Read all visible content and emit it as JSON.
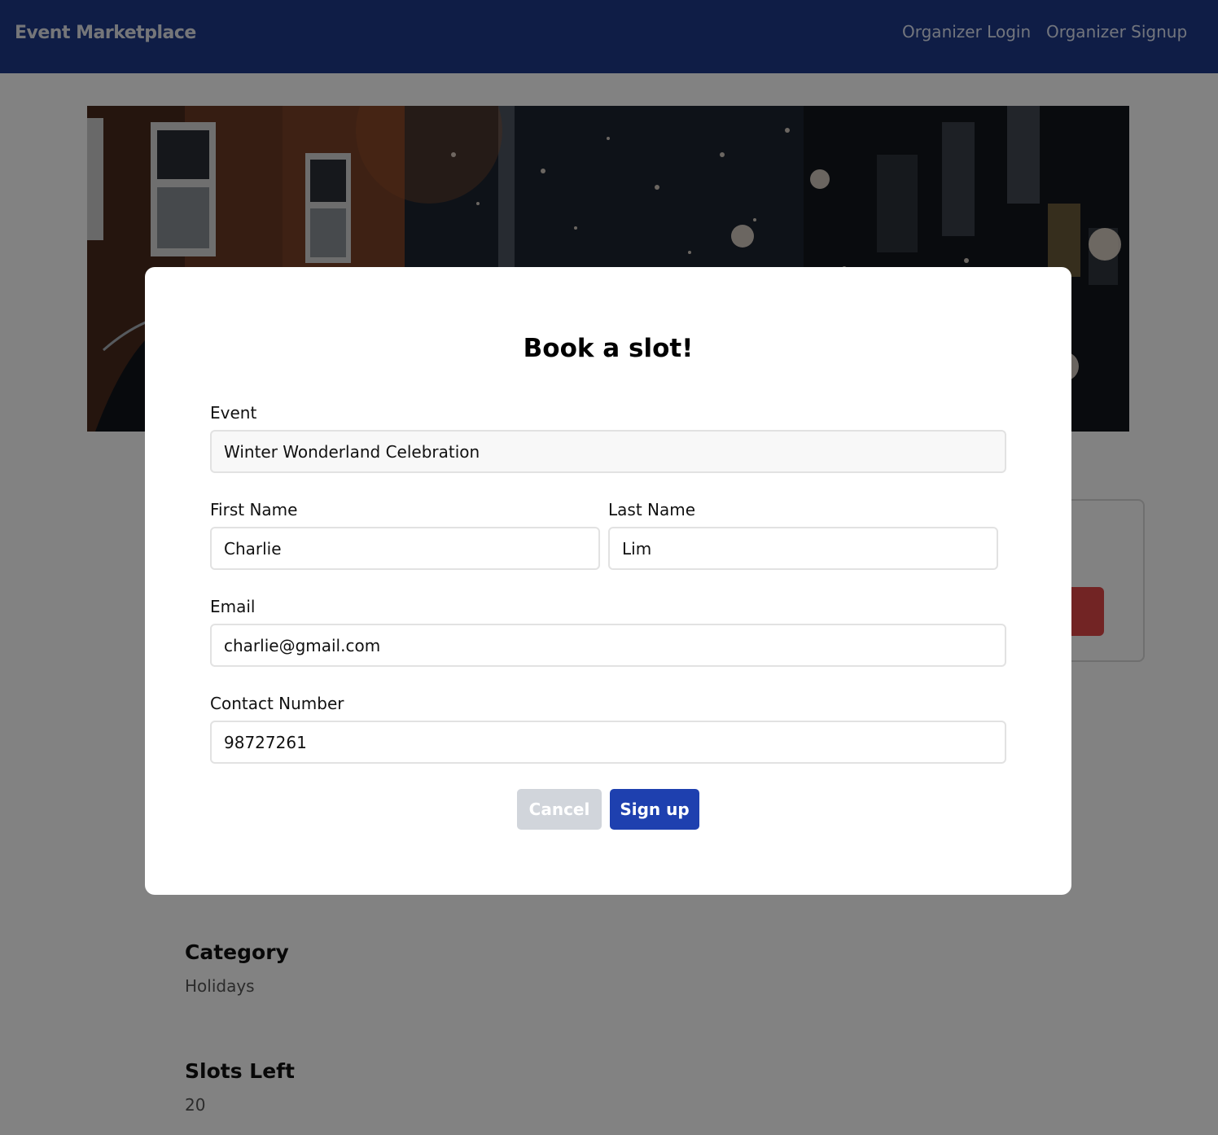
{
  "navbar": {
    "brand": "Event Marketplace",
    "links": [
      "Organizer Login",
      "Organizer Signup"
    ]
  },
  "details": [
    {
      "heading": "Category",
      "value": "Holidays"
    },
    {
      "heading": "Slots Left",
      "value": "20"
    }
  ],
  "modal": {
    "title": "Book a slot!",
    "fields": {
      "event": {
        "label": "Event",
        "value": "Winter Wonderland Celebration"
      },
      "first_name": {
        "label": "First Name",
        "value": "Charlie"
      },
      "last_name": {
        "label": "Last Name",
        "value": "Lim"
      },
      "email": {
        "label": "Email",
        "value": "charlie@gmail.com"
      },
      "contact": {
        "label": "Contact Number",
        "value": "98727261"
      }
    },
    "buttons": {
      "cancel": "Cancel",
      "submit": "Sign up"
    }
  },
  "colors": {
    "navbar_bg": "#1e3a8a",
    "submit_button": "#1e40af",
    "cancel_button": "#d1d5db",
    "side_card_button": "#e04848",
    "overlay": "rgba(0,0,0,0.49)"
  },
  "icons": {
    "banner": "snowy-street-photo"
  }
}
